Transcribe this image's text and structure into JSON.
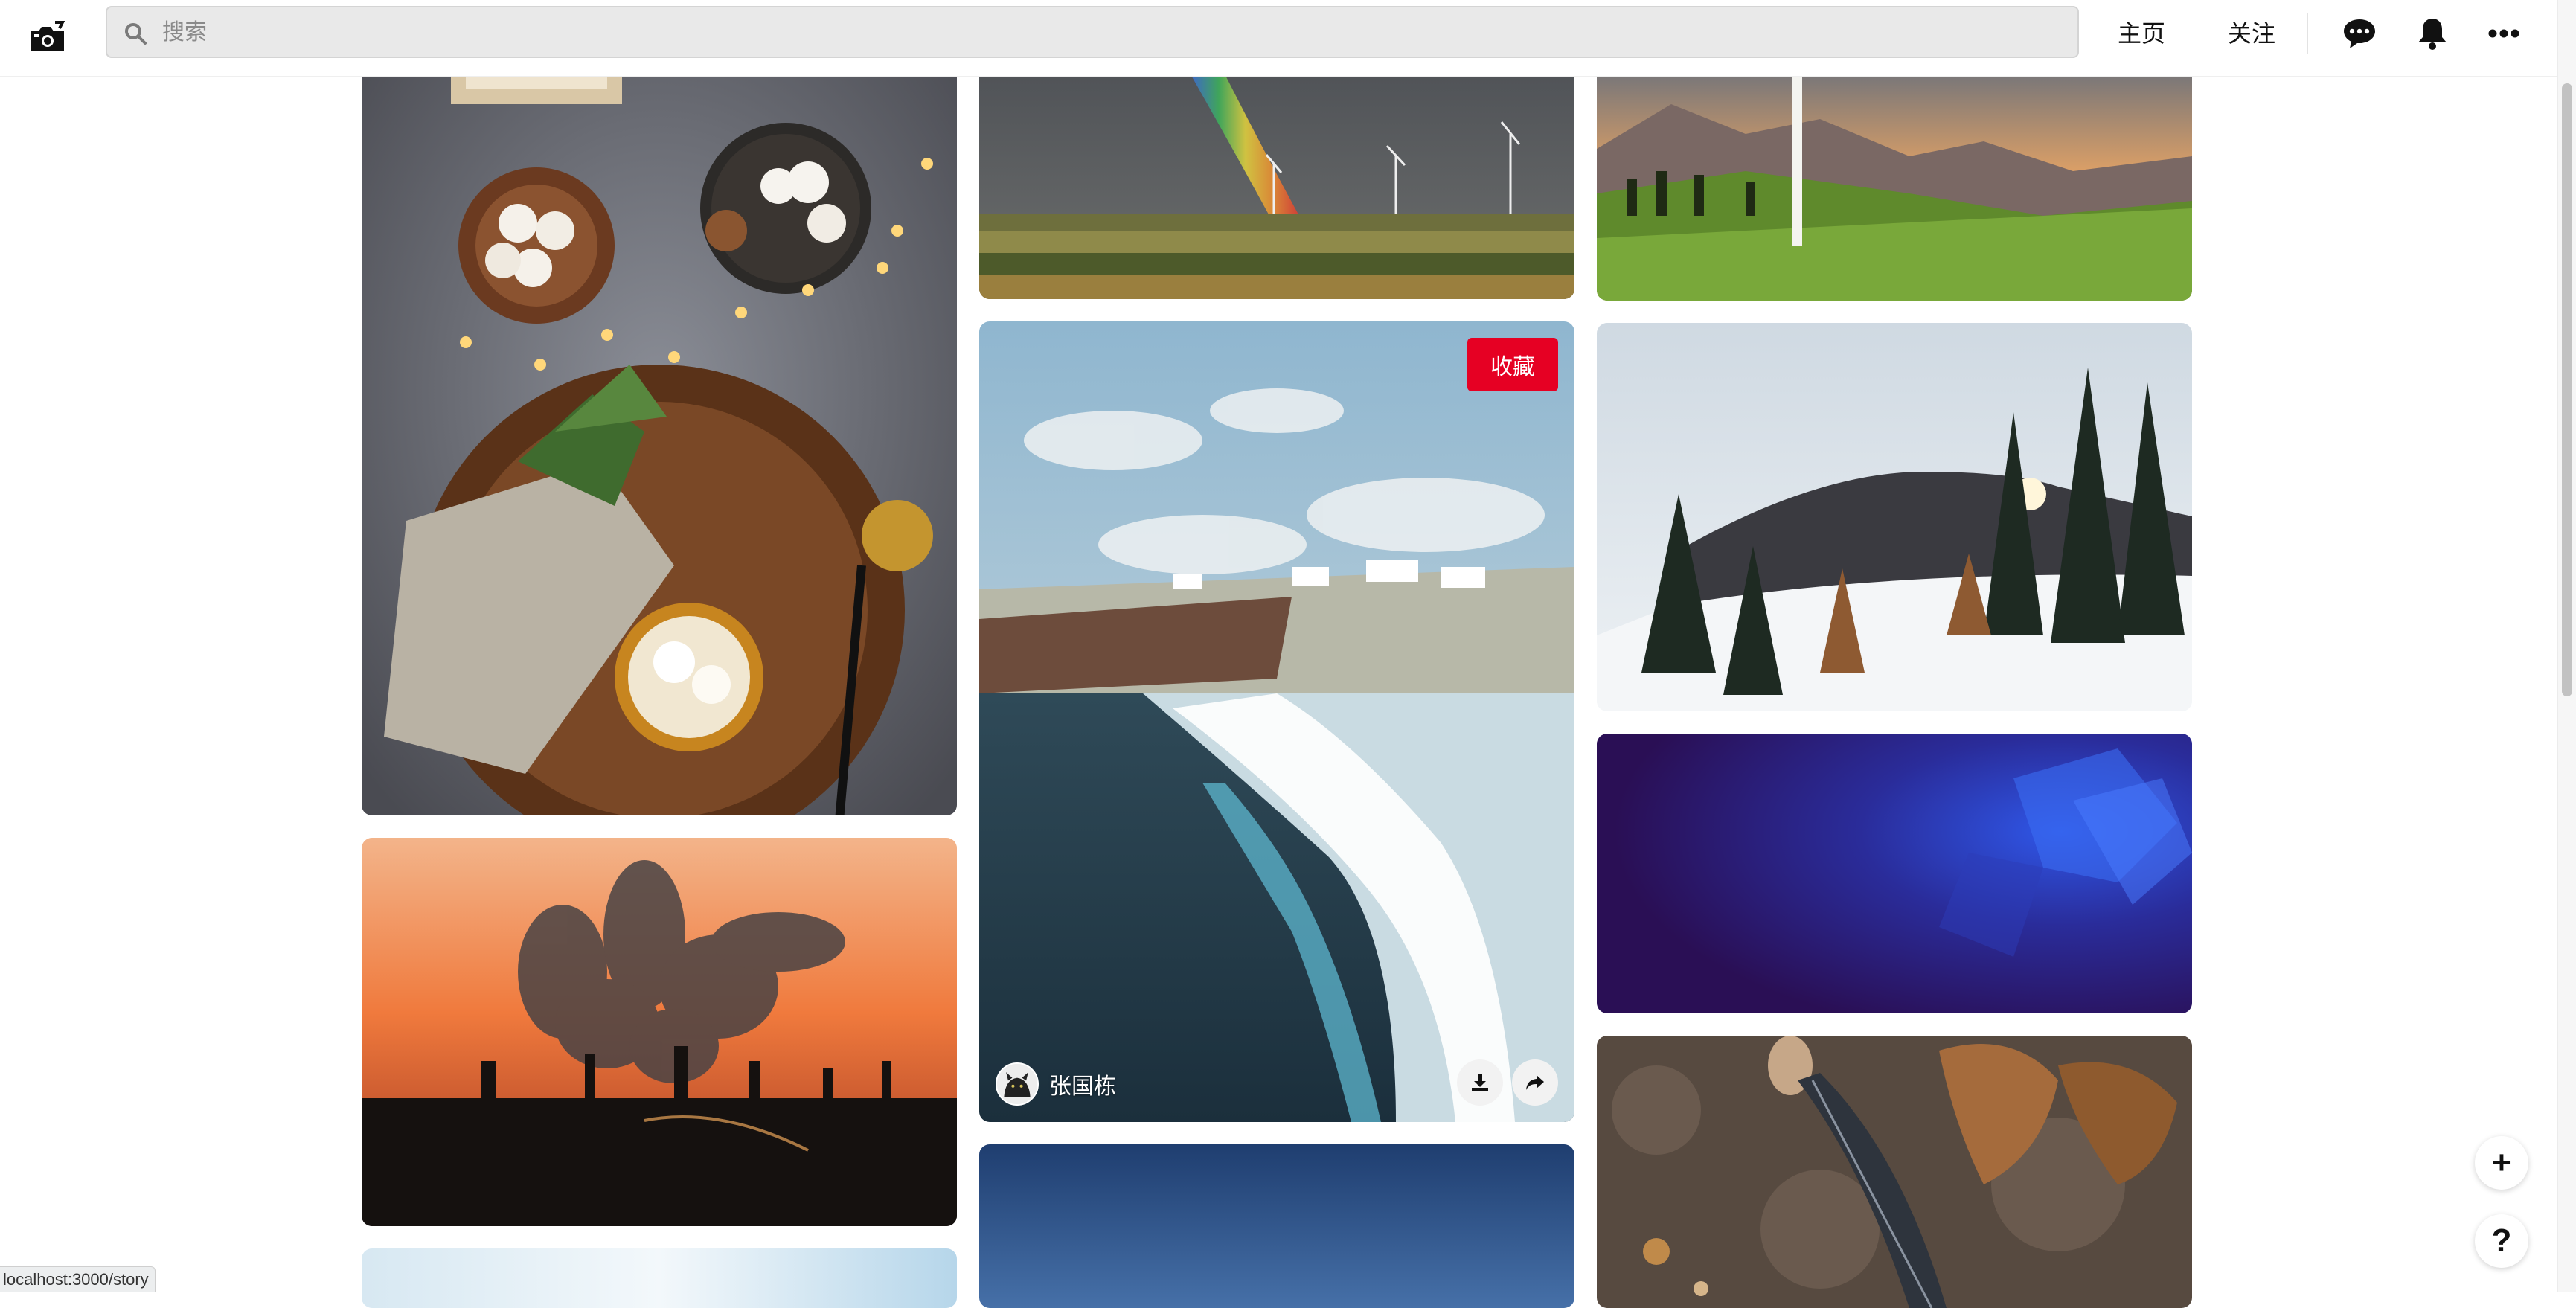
{
  "header": {
    "search_placeholder": "搜索",
    "nav": {
      "home": "主页",
      "following": "关注"
    }
  },
  "pins": {
    "featured": {
      "save_label": "收藏",
      "author_name": "张国栋"
    }
  },
  "floating": {
    "add_label": "+",
    "help_label": "?"
  },
  "status_bar": {
    "url": "localhost:3000/story"
  },
  "colors": {
    "brand_red": "#e60023"
  }
}
